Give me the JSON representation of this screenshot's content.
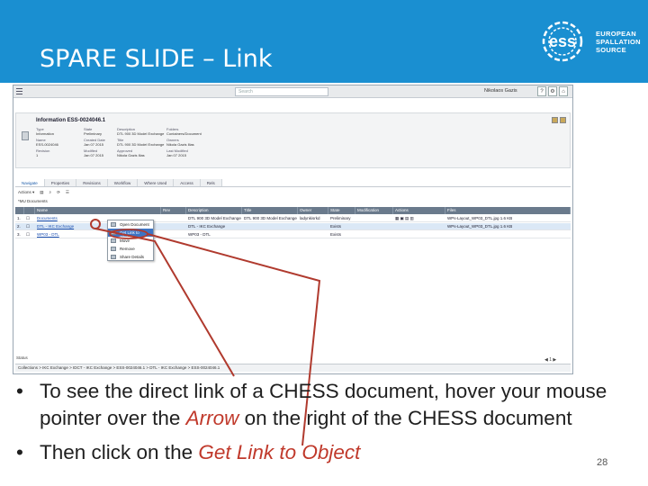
{
  "slide": {
    "title": "SPARE SLIDE – Link",
    "page_number": "28"
  },
  "logo": {
    "mark": "ess",
    "line1": "EUROPEAN",
    "line2": "SPALLATION",
    "line3": "SOURCE"
  },
  "app": {
    "search_placeholder": "Search",
    "user": "Nikolaos Gazis",
    "info_title": "Information ESS-0024046.1",
    "info": [
      {
        "k": "Type",
        "v": "Information"
      },
      {
        "k": "State",
        "v": "Preliminary"
      },
      {
        "k": "Description",
        "v": "DTL 900 3D Model Exchange"
      },
      {
        "k": "Folders",
        "v": "Containers/Document"
      },
      {
        "k": "Name",
        "v": "ESS-0024046"
      },
      {
        "k": "Created Date",
        "v": "Jan 07 2015"
      },
      {
        "k": "Title",
        "v": "DTL 900 3D Model Exchange"
      },
      {
        "k": "Owners",
        "v": "Nikola Gazis Ilias"
      },
      {
        "k": "Revision",
        "v": "1"
      },
      {
        "k": "Modified",
        "v": "Jan 07 2015"
      },
      {
        "k": "Approved",
        "v": "Nikola Gazis Ilias"
      },
      {
        "k": "Last Modified",
        "v": "Jan 07 2015"
      }
    ],
    "tabs": [
      "Navigate",
      "Properties",
      "Revisions",
      "Workflow",
      "Where Used",
      "Access",
      "Rels"
    ],
    "toolbar": [
      "Actions ▾",
      "▤",
      "⌕",
      "⟳",
      "☰"
    ],
    "views_label": "*MU Documents",
    "grid_headers": [
      "",
      "",
      "Name",
      "Rev",
      "Description",
      "Title",
      "Owner",
      "State",
      "Modification",
      "Actions",
      "Files"
    ],
    "rows": [
      {
        "num": "1.",
        "name": "Documents",
        "rev": "",
        "desc": "DTL 900 3D Model Exchange",
        "title": "DTL 900 3D Model Exchange",
        "owner": "ladynkisrkd",
        "state": "Preliminary",
        "files": "WPs-Layout_WP03_DTL.jpg 1.6 KB"
      },
      {
        "num": "2.",
        "name": "DTL - IKC Exchange",
        "rev": "",
        "desc": "DTL - IKC Exchange",
        "title": "",
        "owner": "",
        "state": "Exists",
        "files": "WPs-Layout_WP03_DTL.jpg 1.6 KB"
      },
      {
        "num": "3.",
        "name": "WP03 - DTL",
        "rev": "",
        "desc": "WP03 - DTL",
        "title": "",
        "owner": "",
        "state": "Exists",
        "files": ""
      }
    ],
    "context_menu": [
      "Open Document",
      "Get Link to Object",
      "Move",
      "Remove",
      "Share Details"
    ],
    "status_label": "Status",
    "breadcrumb": "Collections > IKC Exchange > IDCT - IKC Exchange > ESS-0024046.1 > DTL - IKC Exchange > ESS-0024046.1",
    "pager": "◀ 1 ▶"
  },
  "bullets": [
    {
      "before": "To see the direct link of a CHESS document, hover your mouse pointer over the ",
      "em": "Arrow",
      "after": " on the right of the CHESS document"
    },
    {
      "before": "Then click on the ",
      "em": "Get Link to Object",
      "after": ""
    }
  ],
  "colors": {
    "header": "#1a8fd1",
    "annotation": "#b03a2e",
    "emphasis": "#c0392b"
  }
}
